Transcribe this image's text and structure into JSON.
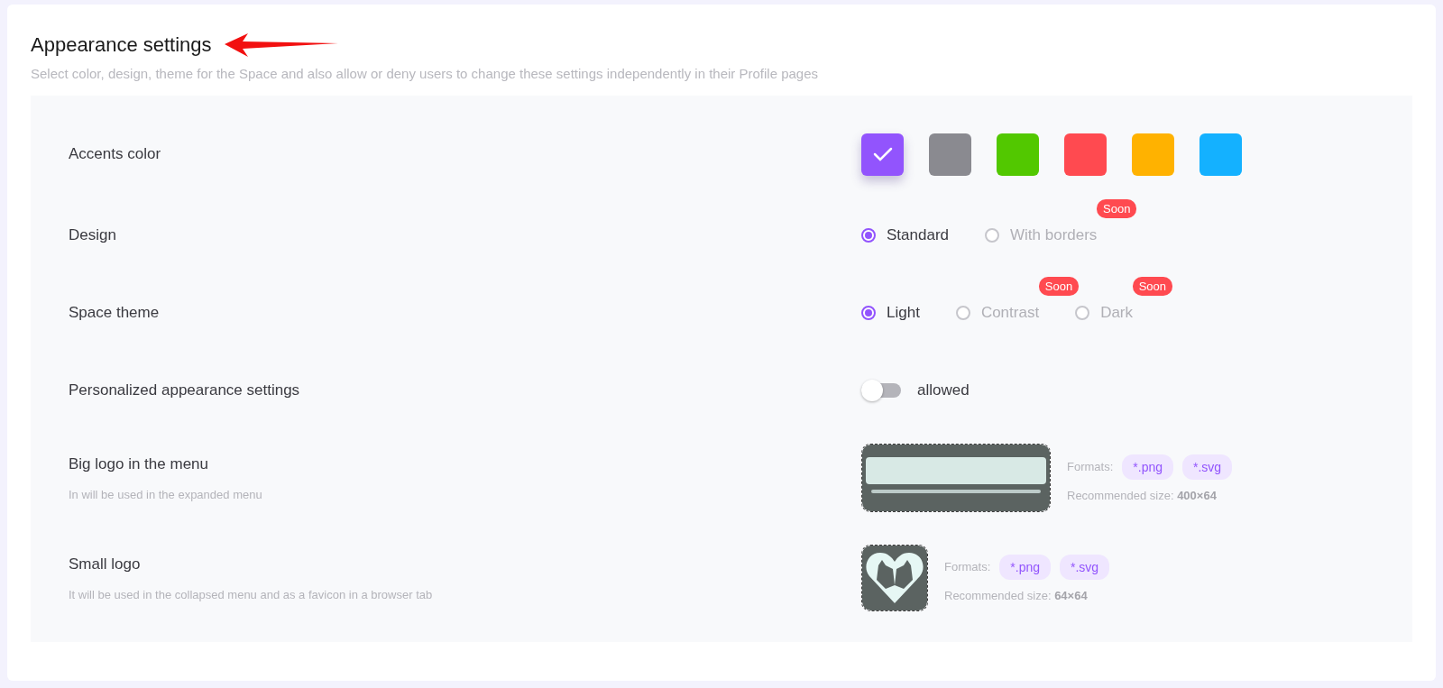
{
  "title": "Appearance settings",
  "subtitle": "Select color, design, theme for the Space and also allow or deny users to change these settings independently in their Profile pages",
  "settings": [
    {
      "kind": "swatches",
      "label": "Accents color",
      "swatches": [
        {
          "color": "#9254fd",
          "selected": true
        },
        {
          "color": "#8a8a90",
          "selected": false
        },
        {
          "color": "#52c800",
          "selected": false
        },
        {
          "color": "#ff4a50",
          "selected": false
        },
        {
          "color": "#ffb200",
          "selected": false
        },
        {
          "color": "#14b1ff",
          "selected": false
        }
      ]
    },
    {
      "kind": "radio",
      "label": "Design",
      "options": [
        {
          "label": "Standard",
          "selected": true,
          "disabled": false
        },
        {
          "label": "With borders",
          "selected": false,
          "disabled": true,
          "badge": "Soon"
        }
      ]
    },
    {
      "kind": "radio",
      "label": "Space theme",
      "options": [
        {
          "label": "Light",
          "selected": true,
          "disabled": false
        },
        {
          "label": "Contrast",
          "selected": false,
          "disabled": true,
          "badge": "Soon"
        },
        {
          "label": "Dark",
          "selected": false,
          "disabled": true,
          "badge": "Soon"
        }
      ]
    },
    {
      "kind": "toggle",
      "label": "Personalized appearance settings",
      "on": false,
      "text": "allowed"
    },
    {
      "kind": "wide_logo",
      "label": "Big logo in the menu",
      "description": "In will be used in the expanded menu",
      "formats_label": "Formats:",
      "formats": [
        "*.png",
        "*.svg"
      ],
      "size_label": "Recommended size:",
      "size_value": "400×64"
    },
    {
      "kind": "square_logo",
      "label": "Small logo",
      "description": "It will be used in the collapsed menu and as a favicon in a browser tab",
      "formats_label": "Formats:",
      "formats": [
        "*.png",
        "*.svg"
      ],
      "size_label": "Recommended size:",
      "size_value": "64×64"
    }
  ]
}
